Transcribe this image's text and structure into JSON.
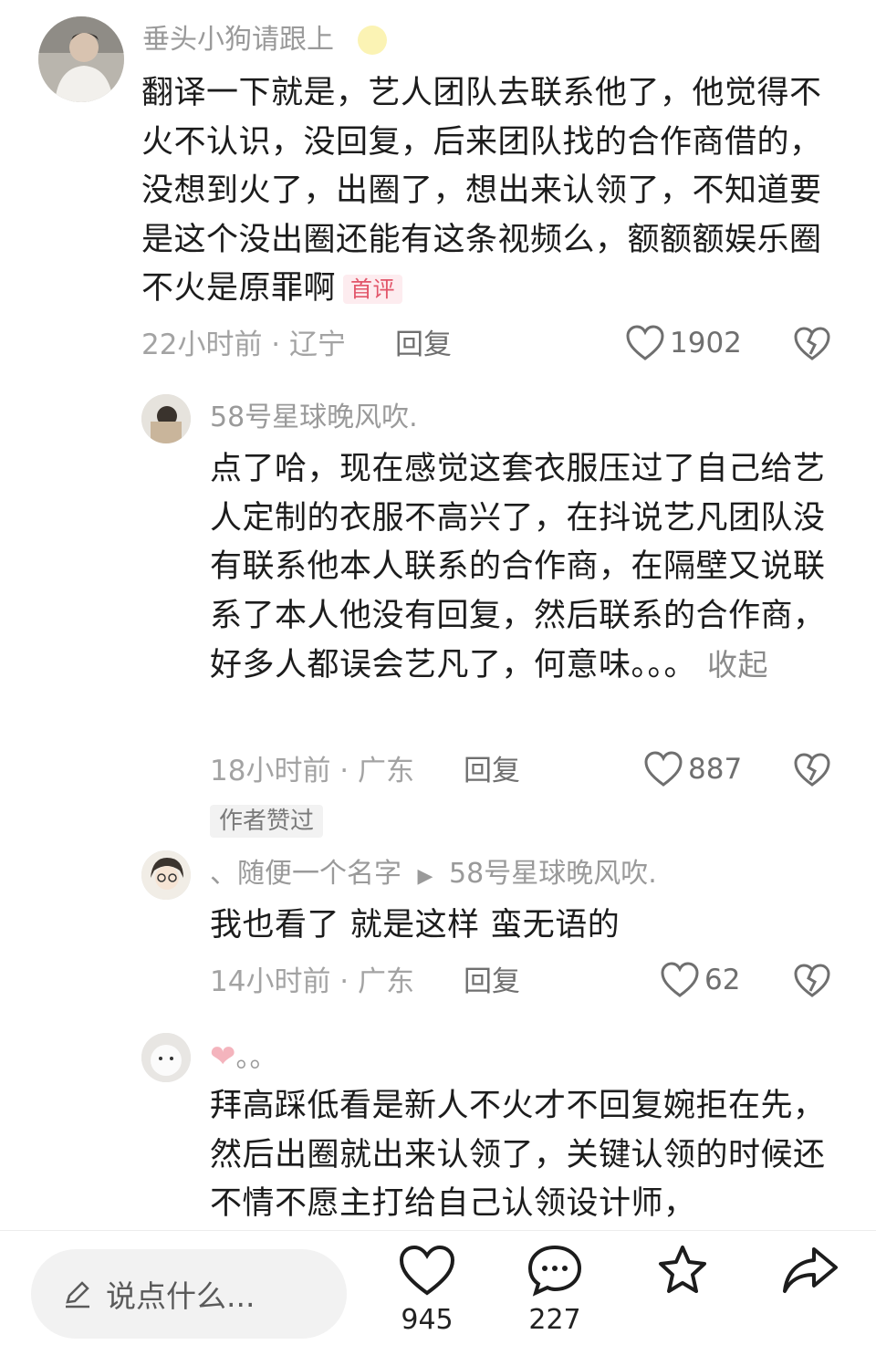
{
  "comments": [
    {
      "username": "垂头小狗请跟上",
      "text": "翻译一下就是，艺人团队去联系他了，他觉得不火不认识，没回复，后来团队找的合作商借的，没想到火了，出圈了，想出来认领了，不知道要是这个没出圈还能有这条视频么，额额额娱乐圈不火是原罪啊",
      "badge": "首评",
      "time": "22小时前",
      "location": "辽宁",
      "reply_label": "回复",
      "likes": "1902"
    },
    {
      "username": "58号星球晚风吹.",
      "text": "点了哈，现在感觉这套衣服压过了自己给艺人定制的衣服不高兴了，在抖说艺凡团队没有联系他本人联系的合作商，在隔壁又说联系了本人他没有回复，然后联系的合作商，好多人都误会艺凡了，何意味。。。",
      "collapse_label": "收起",
      "time": "18小时前",
      "location": "广东",
      "reply_label": "回复",
      "likes": "887",
      "tag": "作者赞过"
    },
    {
      "username": "、随便一个名字",
      "reply_to": "58号星球晚风吹.",
      "text": "我也看了 就是这样 蛮无语的",
      "time": "14小时前",
      "location": "广东",
      "reply_label": "回复",
      "likes": "62"
    },
    {
      "username": "。。",
      "text": "拜高踩低看是新人不火才不回复婉拒在先，然后出圈就出来认领了，关键认领的时候还不情不愿主打给自己认领设计师，"
    }
  ],
  "bottom_bar": {
    "input_placeholder": "说点什么...",
    "likes_count": "945",
    "comments_count": "227",
    "icons": [
      "pen-icon",
      "heart-icon",
      "comment-bubble-icon",
      "star-icon",
      "share-icon"
    ]
  },
  "colors": {
    "meta_gray": "#a3a3a3",
    "badge_red": "#e2566a",
    "text_dark": "#1c1c1c"
  }
}
